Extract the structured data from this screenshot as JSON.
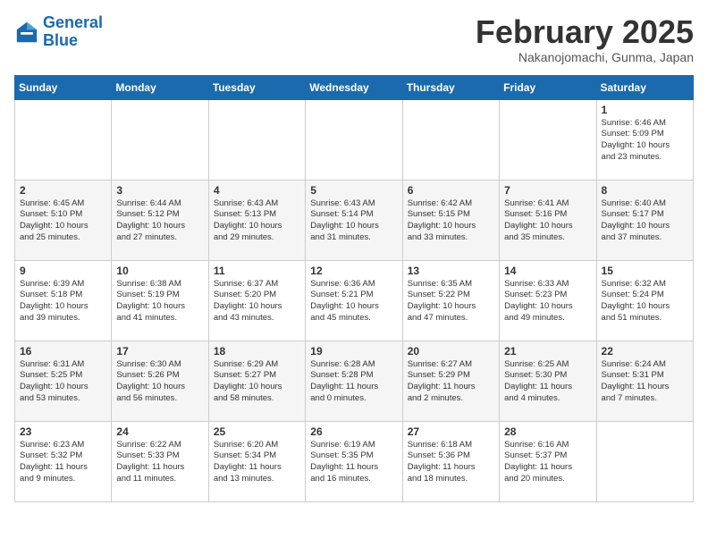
{
  "logo": {
    "line1": "General",
    "line2": "Blue"
  },
  "title": "February 2025",
  "subtitle": "Nakanojomachi, Gunma, Japan",
  "weekdays": [
    "Sunday",
    "Monday",
    "Tuesday",
    "Wednesday",
    "Thursday",
    "Friday",
    "Saturday"
  ],
  "weeks": [
    [
      {
        "day": "",
        "info": ""
      },
      {
        "day": "",
        "info": ""
      },
      {
        "day": "",
        "info": ""
      },
      {
        "day": "",
        "info": ""
      },
      {
        "day": "",
        "info": ""
      },
      {
        "day": "",
        "info": ""
      },
      {
        "day": "1",
        "info": "Sunrise: 6:46 AM\nSunset: 5:09 PM\nDaylight: 10 hours\nand 23 minutes."
      }
    ],
    [
      {
        "day": "2",
        "info": "Sunrise: 6:45 AM\nSunset: 5:10 PM\nDaylight: 10 hours\nand 25 minutes."
      },
      {
        "day": "3",
        "info": "Sunrise: 6:44 AM\nSunset: 5:12 PM\nDaylight: 10 hours\nand 27 minutes."
      },
      {
        "day": "4",
        "info": "Sunrise: 6:43 AM\nSunset: 5:13 PM\nDaylight: 10 hours\nand 29 minutes."
      },
      {
        "day": "5",
        "info": "Sunrise: 6:43 AM\nSunset: 5:14 PM\nDaylight: 10 hours\nand 31 minutes."
      },
      {
        "day": "6",
        "info": "Sunrise: 6:42 AM\nSunset: 5:15 PM\nDaylight: 10 hours\nand 33 minutes."
      },
      {
        "day": "7",
        "info": "Sunrise: 6:41 AM\nSunset: 5:16 PM\nDaylight: 10 hours\nand 35 minutes."
      },
      {
        "day": "8",
        "info": "Sunrise: 6:40 AM\nSunset: 5:17 PM\nDaylight: 10 hours\nand 37 minutes."
      }
    ],
    [
      {
        "day": "9",
        "info": "Sunrise: 6:39 AM\nSunset: 5:18 PM\nDaylight: 10 hours\nand 39 minutes."
      },
      {
        "day": "10",
        "info": "Sunrise: 6:38 AM\nSunset: 5:19 PM\nDaylight: 10 hours\nand 41 minutes."
      },
      {
        "day": "11",
        "info": "Sunrise: 6:37 AM\nSunset: 5:20 PM\nDaylight: 10 hours\nand 43 minutes."
      },
      {
        "day": "12",
        "info": "Sunrise: 6:36 AM\nSunset: 5:21 PM\nDaylight: 10 hours\nand 45 minutes."
      },
      {
        "day": "13",
        "info": "Sunrise: 6:35 AM\nSunset: 5:22 PM\nDaylight: 10 hours\nand 47 minutes."
      },
      {
        "day": "14",
        "info": "Sunrise: 6:33 AM\nSunset: 5:23 PM\nDaylight: 10 hours\nand 49 minutes."
      },
      {
        "day": "15",
        "info": "Sunrise: 6:32 AM\nSunset: 5:24 PM\nDaylight: 10 hours\nand 51 minutes."
      }
    ],
    [
      {
        "day": "16",
        "info": "Sunrise: 6:31 AM\nSunset: 5:25 PM\nDaylight: 10 hours\nand 53 minutes."
      },
      {
        "day": "17",
        "info": "Sunrise: 6:30 AM\nSunset: 5:26 PM\nDaylight: 10 hours\nand 56 minutes."
      },
      {
        "day": "18",
        "info": "Sunrise: 6:29 AM\nSunset: 5:27 PM\nDaylight: 10 hours\nand 58 minutes."
      },
      {
        "day": "19",
        "info": "Sunrise: 6:28 AM\nSunset: 5:28 PM\nDaylight: 11 hours\nand 0 minutes."
      },
      {
        "day": "20",
        "info": "Sunrise: 6:27 AM\nSunset: 5:29 PM\nDaylight: 11 hours\nand 2 minutes."
      },
      {
        "day": "21",
        "info": "Sunrise: 6:25 AM\nSunset: 5:30 PM\nDaylight: 11 hours\nand 4 minutes."
      },
      {
        "day": "22",
        "info": "Sunrise: 6:24 AM\nSunset: 5:31 PM\nDaylight: 11 hours\nand 7 minutes."
      }
    ],
    [
      {
        "day": "23",
        "info": "Sunrise: 6:23 AM\nSunset: 5:32 PM\nDaylight: 11 hours\nand 9 minutes."
      },
      {
        "day": "24",
        "info": "Sunrise: 6:22 AM\nSunset: 5:33 PM\nDaylight: 11 hours\nand 11 minutes."
      },
      {
        "day": "25",
        "info": "Sunrise: 6:20 AM\nSunset: 5:34 PM\nDaylight: 11 hours\nand 13 minutes."
      },
      {
        "day": "26",
        "info": "Sunrise: 6:19 AM\nSunset: 5:35 PM\nDaylight: 11 hours\nand 16 minutes."
      },
      {
        "day": "27",
        "info": "Sunrise: 6:18 AM\nSunset: 5:36 PM\nDaylight: 11 hours\nand 18 minutes."
      },
      {
        "day": "28",
        "info": "Sunrise: 6:16 AM\nSunset: 5:37 PM\nDaylight: 11 hours\nand 20 minutes."
      },
      {
        "day": "",
        "info": ""
      }
    ]
  ]
}
